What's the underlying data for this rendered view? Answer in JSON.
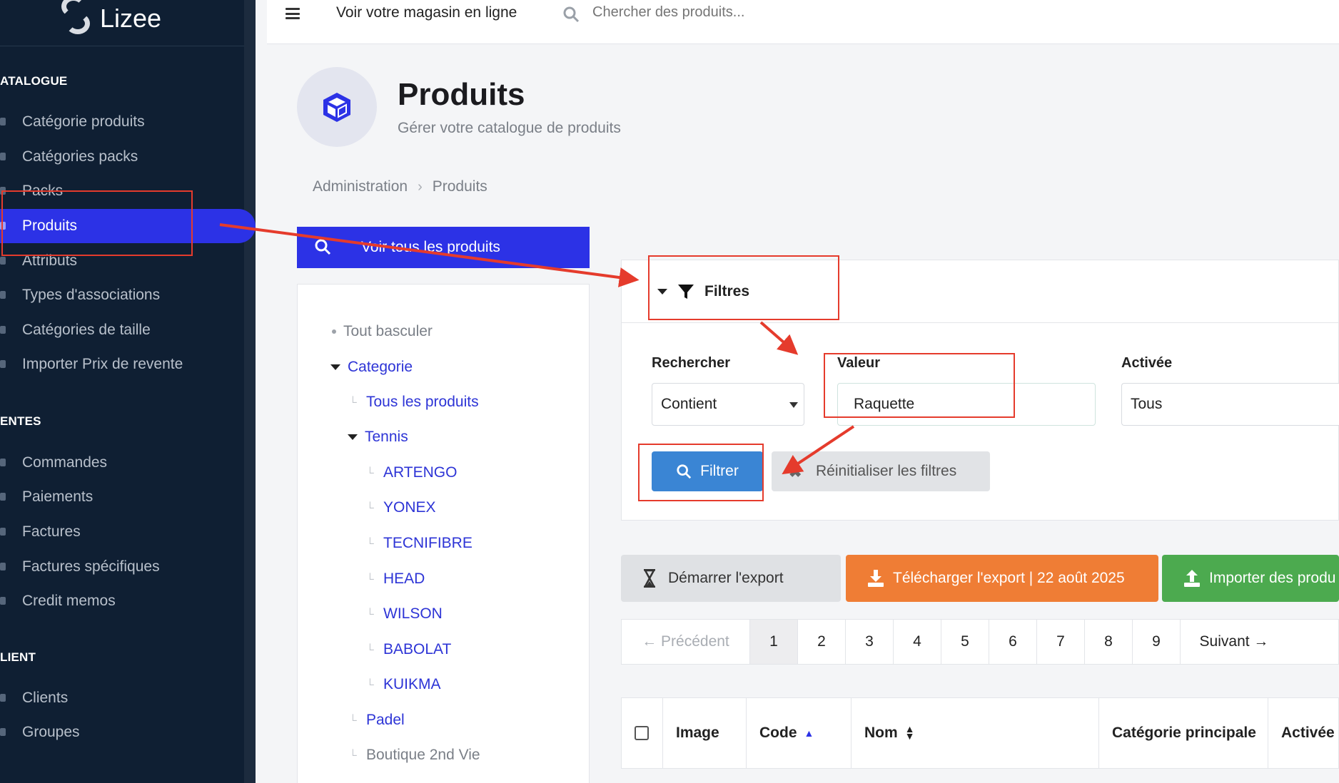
{
  "sidebar": {
    "brand": "Lizee",
    "sections": [
      {
        "title": "ATALOGUE"
      },
      {
        "title": "ENTES"
      },
      {
        "title": "LIENT"
      }
    ],
    "catalogue_items": [
      {
        "label": "Catégorie produits"
      },
      {
        "label": "Catégories packs"
      },
      {
        "label": "Packs"
      },
      {
        "label": "Produits",
        "active": true
      },
      {
        "label": "Attributs"
      },
      {
        "label": "Types d'associations"
      },
      {
        "label": "Catégories de taille"
      },
      {
        "label": "Importer Prix de revente"
      }
    ],
    "ventes_items": [
      {
        "label": "Commandes"
      },
      {
        "label": "Paiements"
      },
      {
        "label": "Factures"
      },
      {
        "label": "Factures spécifiques"
      },
      {
        "label": "Credit memos"
      }
    ],
    "client_items": [
      {
        "label": "Clients"
      },
      {
        "label": "Groupes"
      }
    ]
  },
  "topbar": {
    "store_link": "Voir votre magasin en ligne",
    "search_placeholder": "Chercher des produits..."
  },
  "header": {
    "title": "Produits",
    "subtitle": "Gérer votre catalogue de produits",
    "icon": "cube-icon"
  },
  "breadcrumb": [
    "Administration",
    "Produits"
  ],
  "tree": {
    "view_all_label": "Voir tous les produits",
    "toggle_all": "Tout basculer",
    "root": "Categorie",
    "all_products": "Tous les produits",
    "tennis": "Tennis",
    "brands": [
      "ARTENGO",
      "YONEX",
      "TECNIFIBRE",
      "HEAD",
      "WILSON",
      "BABOLAT",
      "KUIKMA"
    ],
    "padel": "Padel",
    "boutique": "Boutique 2nd Vie"
  },
  "filters": {
    "title": "Filtres",
    "search_label": "Rechercher",
    "search_mode": "Contient",
    "value_label": "Valeur",
    "value": "Raquette",
    "enabled_label": "Activée",
    "enabled_value": "Tous",
    "filter_button": "Filtrer",
    "reset_button": "Réinitialiser les filtres"
  },
  "actions": {
    "export": "Démarrer l'export",
    "download": "Télécharger l'export | 22 août 2025",
    "import": "Importer des produ"
  },
  "pagination": {
    "prev": "← Précédent",
    "pages": [
      "1",
      "2",
      "3",
      "4",
      "5",
      "6",
      "7",
      "8",
      "9"
    ],
    "current": "1",
    "next": "Suivant →"
  },
  "table": {
    "columns": [
      "Image",
      "Code",
      "Nom",
      "Catégorie principale",
      "Activée"
    ]
  },
  "colors": {
    "sidebar_bg": "#0f1f33",
    "accent": "#2c32e6",
    "filter_button": "#3a85d4",
    "download_button": "#ef7d35",
    "import_button": "#4caa4f",
    "annotation_red": "#e53b2c"
  }
}
